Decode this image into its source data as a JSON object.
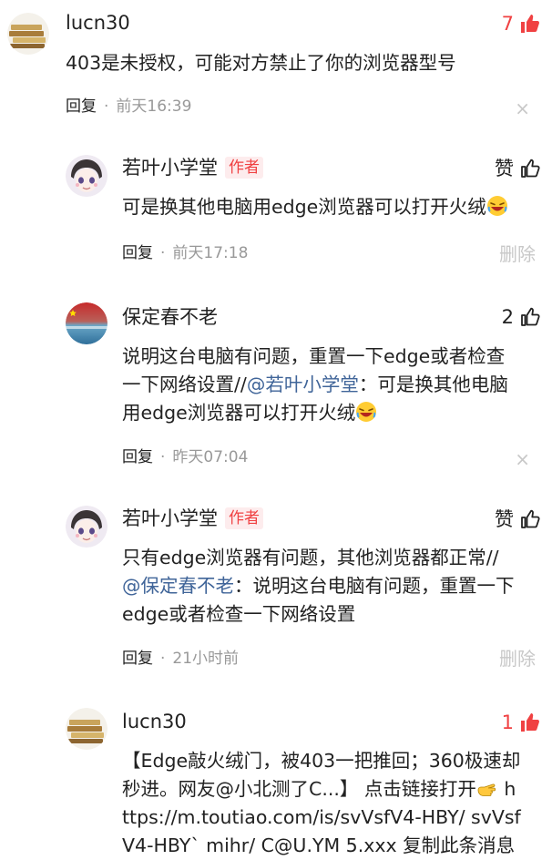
{
  "comments": [
    {
      "user": "lucn30",
      "likes": "7",
      "text": "403是未授权，可能对方禁止了你的浏览器型号",
      "reply": "回复",
      "sep": "·",
      "time": "前天16:39",
      "action": "×"
    },
    {
      "user": "若叶小学堂",
      "badge": "作者",
      "likes": "赞",
      "text": "可是换其他电脑用edge浏览器可以打开火绒",
      "reply": "回复",
      "sep": "·",
      "time": "前天17:18",
      "action": "删除"
    },
    {
      "user": "保定春不老",
      "likes": "2",
      "line1": "说明这台电脑有问题，重置一下edge或者检查",
      "line2a": "一下网络设置//",
      "mention": "@若叶小学堂",
      "line2b": "：可是换其他电脑",
      "line3": "用edge浏览器可以打开火绒",
      "reply": "回复",
      "sep": "·",
      "time": "昨天07:04",
      "action": "×"
    },
    {
      "user": "若叶小学堂",
      "badge": "作者",
      "likes": "赞",
      "line1": "只有edge浏览器有问题，其他浏览器都正常//",
      "mention": "@保定春不老",
      "line2b": "：说明这台电脑有问题，重置一下",
      "line3": "edge或者检查一下网络设置",
      "reply": "回复",
      "sep": "·",
      "time": "21小时前",
      "action": "删除"
    },
    {
      "user": "lucn30",
      "likes": "1",
      "line1": "【Edge敲火绒门，被403一把推回；360极速却",
      "line2": "秒进。网友@小北测了C...】 点击链接打开",
      "line2tail": " h",
      "line3": "ttps://m.toutiao.com/is/svVsfV4-HBY/ svVsf",
      "line4": "V4-HBY` mihr/ C@U.YM 5.xxx 复制此条消息"
    }
  ],
  "colors": {
    "accent": "#f04142",
    "mention": "#406599",
    "muted": "#999999",
    "disabled": "#c8c8c8"
  }
}
